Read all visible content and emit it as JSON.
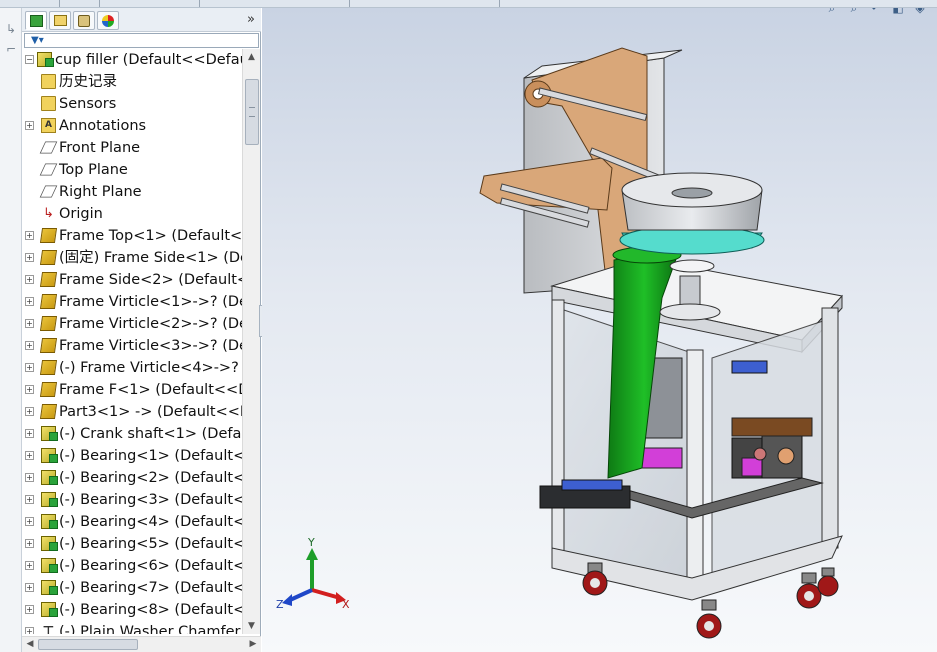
{
  "panel": {
    "collapse_arrow": "»",
    "tabs": [
      {
        "name": "feature-manager-tab",
        "icon": "feature-tree-icon"
      },
      {
        "name": "property-manager-tab",
        "icon": "property-icon"
      },
      {
        "name": "configuration-manager-tab",
        "icon": "configuration-icon"
      },
      {
        "name": "display-manager-tab",
        "icon": "appearance-icon"
      }
    ],
    "filter_icon": "funnel-icon"
  },
  "tree": {
    "root": "cup filler  (Default<<Default",
    "items": [
      {
        "label": "历史记录",
        "icon": "history-folder",
        "toggle": ""
      },
      {
        "label": "Sensors",
        "icon": "folder",
        "toggle": ""
      },
      {
        "label": "Annotations",
        "icon": "annotation",
        "toggle": "+"
      },
      {
        "label": "Front Plane",
        "icon": "plane",
        "toggle": ""
      },
      {
        "label": "Top Plane",
        "icon": "plane",
        "toggle": ""
      },
      {
        "label": "Right Plane",
        "icon": "plane",
        "toggle": ""
      },
      {
        "label": "Origin",
        "icon": "origin",
        "toggle": ""
      },
      {
        "label": "Frame Top<1> (Default<",
        "icon": "part",
        "toggle": "+"
      },
      {
        "label": "(固定) Frame Side<1> (De",
        "icon": "part",
        "toggle": "+"
      },
      {
        "label": "Frame Side<2> (Default<",
        "icon": "part",
        "toggle": "+"
      },
      {
        "label": "Frame Virticle<1>->? (De",
        "icon": "part",
        "toggle": "+"
      },
      {
        "label": "Frame Virticle<2>->? (De",
        "icon": "part",
        "toggle": "+"
      },
      {
        "label": "Frame Virticle<3>->? (De",
        "icon": "part",
        "toggle": "+"
      },
      {
        "label": "(-) Frame Virticle<4>->?",
        "icon": "part",
        "toggle": "+"
      },
      {
        "label": "Frame F<1> (Default<<D",
        "icon": "part",
        "toggle": "+"
      },
      {
        "label": "Part3<1> -> (Default<<D",
        "icon": "part",
        "toggle": "+"
      },
      {
        "label": "(-) Crank shaft<1> (Defau",
        "icon": "assembly",
        "toggle": "+"
      },
      {
        "label": "(-) Bearing<1> (Default<",
        "icon": "assembly",
        "toggle": "+"
      },
      {
        "label": "(-) Bearing<2> (Default<",
        "icon": "assembly",
        "toggle": "+"
      },
      {
        "label": "(-) Bearing<3> (Default<",
        "icon": "assembly",
        "toggle": "+"
      },
      {
        "label": "(-) Bearing<4> (Default<",
        "icon": "assembly",
        "toggle": "+"
      },
      {
        "label": "(-) Bearing<5> (Default<",
        "icon": "assembly",
        "toggle": "+"
      },
      {
        "label": "(-) Bearing<6> (Default<",
        "icon": "assembly",
        "toggle": "+"
      },
      {
        "label": "(-) Bearing<7> (Default<",
        "icon": "assembly",
        "toggle": "+"
      },
      {
        "label": "(-) Bearing<8> (Default<",
        "icon": "assembly",
        "toggle": "+"
      },
      {
        "label": "(-) Plain Washer Chamfer",
        "icon": "washer",
        "toggle": "+"
      }
    ]
  },
  "triad": {
    "x": "X",
    "y": "Y",
    "z": "Z"
  },
  "colors": {
    "panel_bg": "#ffffff",
    "viewport_top": "#c9d3e3",
    "viewport_bottom": "#f7f9fb",
    "chute_green": "#12a01a",
    "bowl_cyan": "#4fd6c8",
    "bracket_tan": "#d9a779"
  }
}
